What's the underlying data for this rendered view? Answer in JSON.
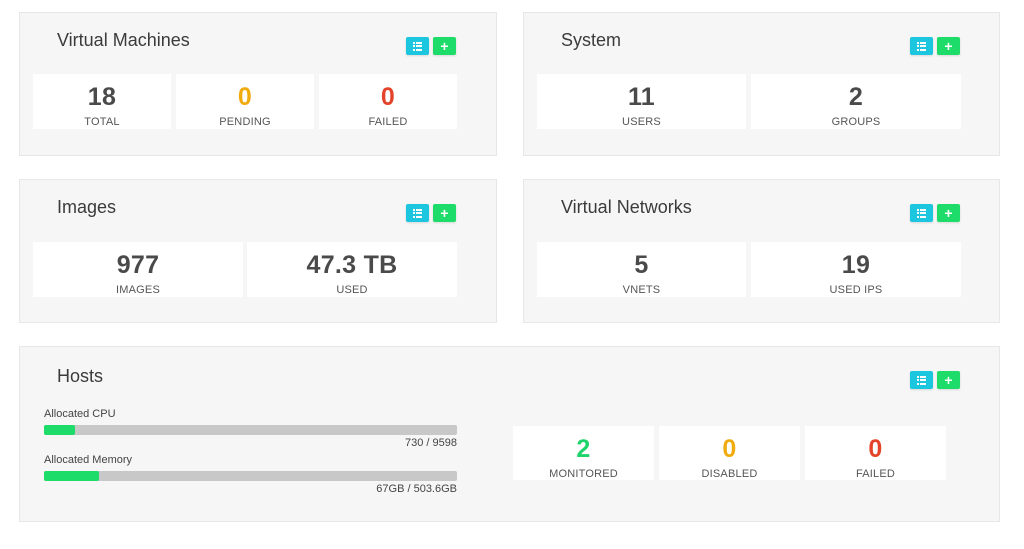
{
  "vm": {
    "title": "Virtual Machines",
    "stats": [
      {
        "value": "18",
        "label": "TOTAL"
      },
      {
        "value": "0",
        "label": "PENDING"
      },
      {
        "value": "0",
        "label": "FAILED"
      }
    ]
  },
  "system": {
    "title": "System",
    "stats": [
      {
        "value": "11",
        "label": "USERS"
      },
      {
        "value": "2",
        "label": "GROUPS"
      }
    ]
  },
  "images": {
    "title": "Images",
    "stats": [
      {
        "value": "977",
        "label": "IMAGES"
      },
      {
        "value": "47.3 TB",
        "label": "USED"
      }
    ]
  },
  "vnets": {
    "title": "Virtual Networks",
    "stats": [
      {
        "value": "5",
        "label": "VNETS"
      },
      {
        "value": "19",
        "label": "USED IPS"
      }
    ]
  },
  "hosts": {
    "title": "Hosts",
    "cpu": {
      "label": "Allocated CPU",
      "text": "730 / 9598",
      "fraction": 0.076
    },
    "memory": {
      "label": "Allocated Memory",
      "text": "67GB / 503.6GB",
      "fraction": 0.133
    },
    "stats": [
      {
        "value": "2",
        "label": "MONITORED"
      },
      {
        "value": "0",
        "label": "DISABLED"
      },
      {
        "value": "0",
        "label": "FAILED"
      }
    ]
  },
  "icons": {
    "list": "list-icon",
    "add": "plus-icon"
  },
  "colors": {
    "list_button": "#1cc6de",
    "add_button": "#1edc6a",
    "warning": "#f0ac0e",
    "error": "#e4442a",
    "success": "#1ed369"
  }
}
